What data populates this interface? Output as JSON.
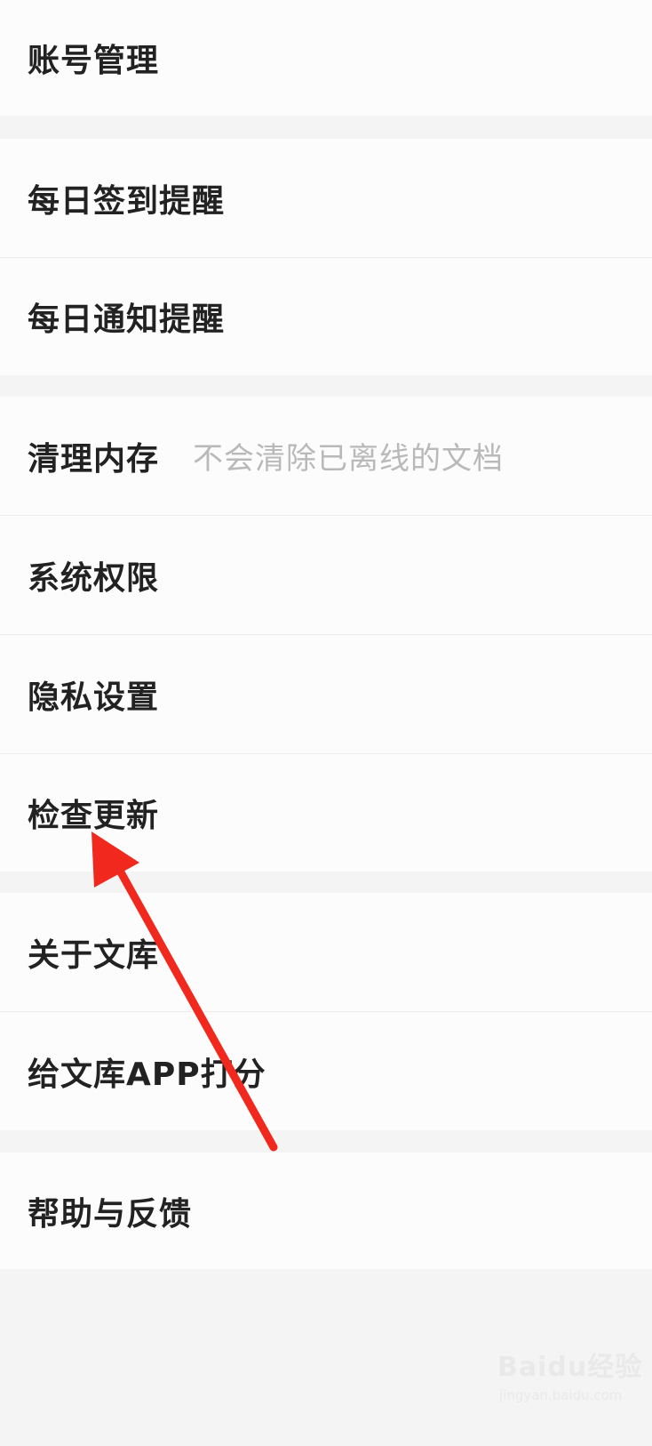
{
  "settings": {
    "items": [
      {
        "label": "账号管理"
      },
      {
        "label": "每日签到提醒"
      },
      {
        "label": "每日通知提醒"
      },
      {
        "label": "清理内存",
        "hint": "不会清除已离线的文档"
      },
      {
        "label": "系统权限"
      },
      {
        "label": "隐私设置"
      },
      {
        "label": "检查更新"
      },
      {
        "label": "关于文库"
      },
      {
        "label": "给文库APP打分"
      },
      {
        "label": "帮助与反馈"
      }
    ]
  },
  "annotation": {
    "arrow_color": "#f0281e",
    "target": "检查更新"
  },
  "watermark": {
    "logo": "Baidu经验",
    "url": "jingyan.baidu.com"
  },
  "colors": {
    "background": "#f4f4f4",
    "row": "#fcfcfc",
    "label": "#222222",
    "hint": "#b9b9b9"
  }
}
